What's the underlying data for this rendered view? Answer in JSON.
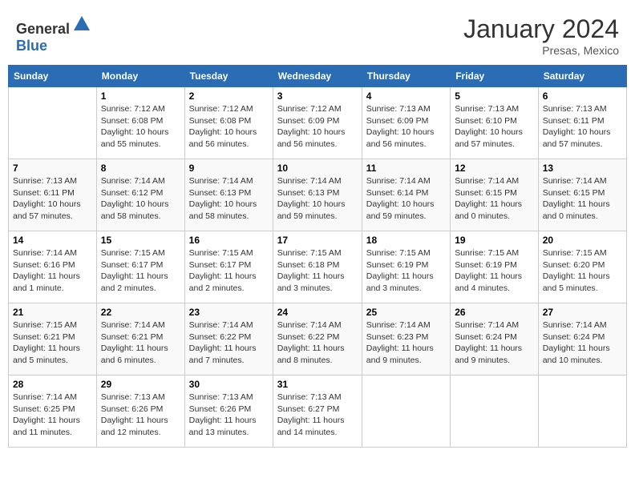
{
  "header": {
    "logo_general": "General",
    "logo_blue": "Blue",
    "month_year": "January 2024",
    "location": "Presas, Mexico"
  },
  "weekdays": [
    "Sunday",
    "Monday",
    "Tuesday",
    "Wednesday",
    "Thursday",
    "Friday",
    "Saturday"
  ],
  "weeks": [
    [
      {
        "day": "",
        "sunrise": "",
        "sunset": "",
        "daylight": ""
      },
      {
        "day": "1",
        "sunrise": "Sunrise: 7:12 AM",
        "sunset": "Sunset: 6:08 PM",
        "daylight": "Daylight: 10 hours and 55 minutes."
      },
      {
        "day": "2",
        "sunrise": "Sunrise: 7:12 AM",
        "sunset": "Sunset: 6:08 PM",
        "daylight": "Daylight: 10 hours and 56 minutes."
      },
      {
        "day": "3",
        "sunrise": "Sunrise: 7:12 AM",
        "sunset": "Sunset: 6:09 PM",
        "daylight": "Daylight: 10 hours and 56 minutes."
      },
      {
        "day": "4",
        "sunrise": "Sunrise: 7:13 AM",
        "sunset": "Sunset: 6:09 PM",
        "daylight": "Daylight: 10 hours and 56 minutes."
      },
      {
        "day": "5",
        "sunrise": "Sunrise: 7:13 AM",
        "sunset": "Sunset: 6:10 PM",
        "daylight": "Daylight: 10 hours and 57 minutes."
      },
      {
        "day": "6",
        "sunrise": "Sunrise: 7:13 AM",
        "sunset": "Sunset: 6:11 PM",
        "daylight": "Daylight: 10 hours and 57 minutes."
      }
    ],
    [
      {
        "day": "7",
        "sunrise": "Sunrise: 7:13 AM",
        "sunset": "Sunset: 6:11 PM",
        "daylight": "Daylight: 10 hours and 57 minutes."
      },
      {
        "day": "8",
        "sunrise": "Sunrise: 7:14 AM",
        "sunset": "Sunset: 6:12 PM",
        "daylight": "Daylight: 10 hours and 58 minutes."
      },
      {
        "day": "9",
        "sunrise": "Sunrise: 7:14 AM",
        "sunset": "Sunset: 6:13 PM",
        "daylight": "Daylight: 10 hours and 58 minutes."
      },
      {
        "day": "10",
        "sunrise": "Sunrise: 7:14 AM",
        "sunset": "Sunset: 6:13 PM",
        "daylight": "Daylight: 10 hours and 59 minutes."
      },
      {
        "day": "11",
        "sunrise": "Sunrise: 7:14 AM",
        "sunset": "Sunset: 6:14 PM",
        "daylight": "Daylight: 10 hours and 59 minutes."
      },
      {
        "day": "12",
        "sunrise": "Sunrise: 7:14 AM",
        "sunset": "Sunset: 6:15 PM",
        "daylight": "Daylight: 11 hours and 0 minutes."
      },
      {
        "day": "13",
        "sunrise": "Sunrise: 7:14 AM",
        "sunset": "Sunset: 6:15 PM",
        "daylight": "Daylight: 11 hours and 0 minutes."
      }
    ],
    [
      {
        "day": "14",
        "sunrise": "Sunrise: 7:14 AM",
        "sunset": "Sunset: 6:16 PM",
        "daylight": "Daylight: 11 hours and 1 minute."
      },
      {
        "day": "15",
        "sunrise": "Sunrise: 7:15 AM",
        "sunset": "Sunset: 6:17 PM",
        "daylight": "Daylight: 11 hours and 2 minutes."
      },
      {
        "day": "16",
        "sunrise": "Sunrise: 7:15 AM",
        "sunset": "Sunset: 6:17 PM",
        "daylight": "Daylight: 11 hours and 2 minutes."
      },
      {
        "day": "17",
        "sunrise": "Sunrise: 7:15 AM",
        "sunset": "Sunset: 6:18 PM",
        "daylight": "Daylight: 11 hours and 3 minutes."
      },
      {
        "day": "18",
        "sunrise": "Sunrise: 7:15 AM",
        "sunset": "Sunset: 6:19 PM",
        "daylight": "Daylight: 11 hours and 3 minutes."
      },
      {
        "day": "19",
        "sunrise": "Sunrise: 7:15 AM",
        "sunset": "Sunset: 6:19 PM",
        "daylight": "Daylight: 11 hours and 4 minutes."
      },
      {
        "day": "20",
        "sunrise": "Sunrise: 7:15 AM",
        "sunset": "Sunset: 6:20 PM",
        "daylight": "Daylight: 11 hours and 5 minutes."
      }
    ],
    [
      {
        "day": "21",
        "sunrise": "Sunrise: 7:15 AM",
        "sunset": "Sunset: 6:21 PM",
        "daylight": "Daylight: 11 hours and 5 minutes."
      },
      {
        "day": "22",
        "sunrise": "Sunrise: 7:14 AM",
        "sunset": "Sunset: 6:21 PM",
        "daylight": "Daylight: 11 hours and 6 minutes."
      },
      {
        "day": "23",
        "sunrise": "Sunrise: 7:14 AM",
        "sunset": "Sunset: 6:22 PM",
        "daylight": "Daylight: 11 hours and 7 minutes."
      },
      {
        "day": "24",
        "sunrise": "Sunrise: 7:14 AM",
        "sunset": "Sunset: 6:22 PM",
        "daylight": "Daylight: 11 hours and 8 minutes."
      },
      {
        "day": "25",
        "sunrise": "Sunrise: 7:14 AM",
        "sunset": "Sunset: 6:23 PM",
        "daylight": "Daylight: 11 hours and 9 minutes."
      },
      {
        "day": "26",
        "sunrise": "Sunrise: 7:14 AM",
        "sunset": "Sunset: 6:24 PM",
        "daylight": "Daylight: 11 hours and 9 minutes."
      },
      {
        "day": "27",
        "sunrise": "Sunrise: 7:14 AM",
        "sunset": "Sunset: 6:24 PM",
        "daylight": "Daylight: 11 hours and 10 minutes."
      }
    ],
    [
      {
        "day": "28",
        "sunrise": "Sunrise: 7:14 AM",
        "sunset": "Sunset: 6:25 PM",
        "daylight": "Daylight: 11 hours and 11 minutes."
      },
      {
        "day": "29",
        "sunrise": "Sunrise: 7:13 AM",
        "sunset": "Sunset: 6:26 PM",
        "daylight": "Daylight: 11 hours and 12 minutes."
      },
      {
        "day": "30",
        "sunrise": "Sunrise: 7:13 AM",
        "sunset": "Sunset: 6:26 PM",
        "daylight": "Daylight: 11 hours and 13 minutes."
      },
      {
        "day": "31",
        "sunrise": "Sunrise: 7:13 AM",
        "sunset": "Sunset: 6:27 PM",
        "daylight": "Daylight: 11 hours and 14 minutes."
      },
      {
        "day": "",
        "sunrise": "",
        "sunset": "",
        "daylight": ""
      },
      {
        "day": "",
        "sunrise": "",
        "sunset": "",
        "daylight": ""
      },
      {
        "day": "",
        "sunrise": "",
        "sunset": "",
        "daylight": ""
      }
    ]
  ]
}
